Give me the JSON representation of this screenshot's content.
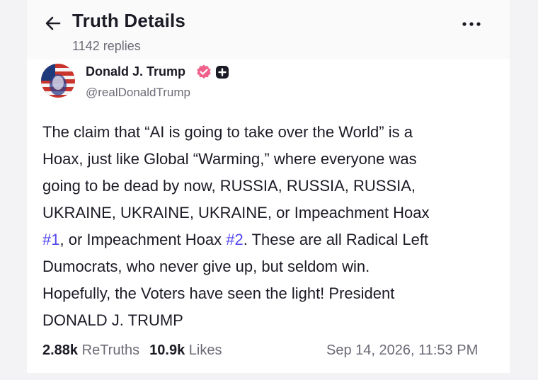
{
  "header": {
    "title": "Truth Details",
    "replies": "1142 replies"
  },
  "author": {
    "name": "Donald J. Trump",
    "handle": "@realDonaldTrump"
  },
  "post": {
    "text_1": "The claim that “AI is going to take over the World” is a\nHoax, just like Global “Warming,” where everyone was\ngoing to be dead by now, RUSSIA, RUSSIA, RUSSIA,\nUKRAINE, UKRAINE, UKRAINE, or Impeachment Hoax\n",
    "hashtag_1": "#1",
    "text_2": ", or Impeachment Hoax ",
    "hashtag_2": "#2",
    "text_3": ". These are all Radical Left\nDumocrats, who never give up, but seldom win.\nHopefully, the Voters have seen the light! President\nDONALD J. TRUMP"
  },
  "stats": {
    "retruths_count": "2.88k",
    "retruths_label": "ReTruths",
    "likes_count": "10.9k",
    "likes_label": "Likes",
    "timestamp": "Sep 14, 2026, 11:53 PM"
  },
  "icons": {
    "back": "arrow-left-icon",
    "more": "more-horizontal-icon",
    "verified": "verified-badge-icon",
    "plus": "plus-badge-icon"
  },
  "colors": {
    "text": "#1b1b26",
    "muted": "#6b6b76",
    "link": "#5448ee",
    "verified": "#f0628c"
  }
}
